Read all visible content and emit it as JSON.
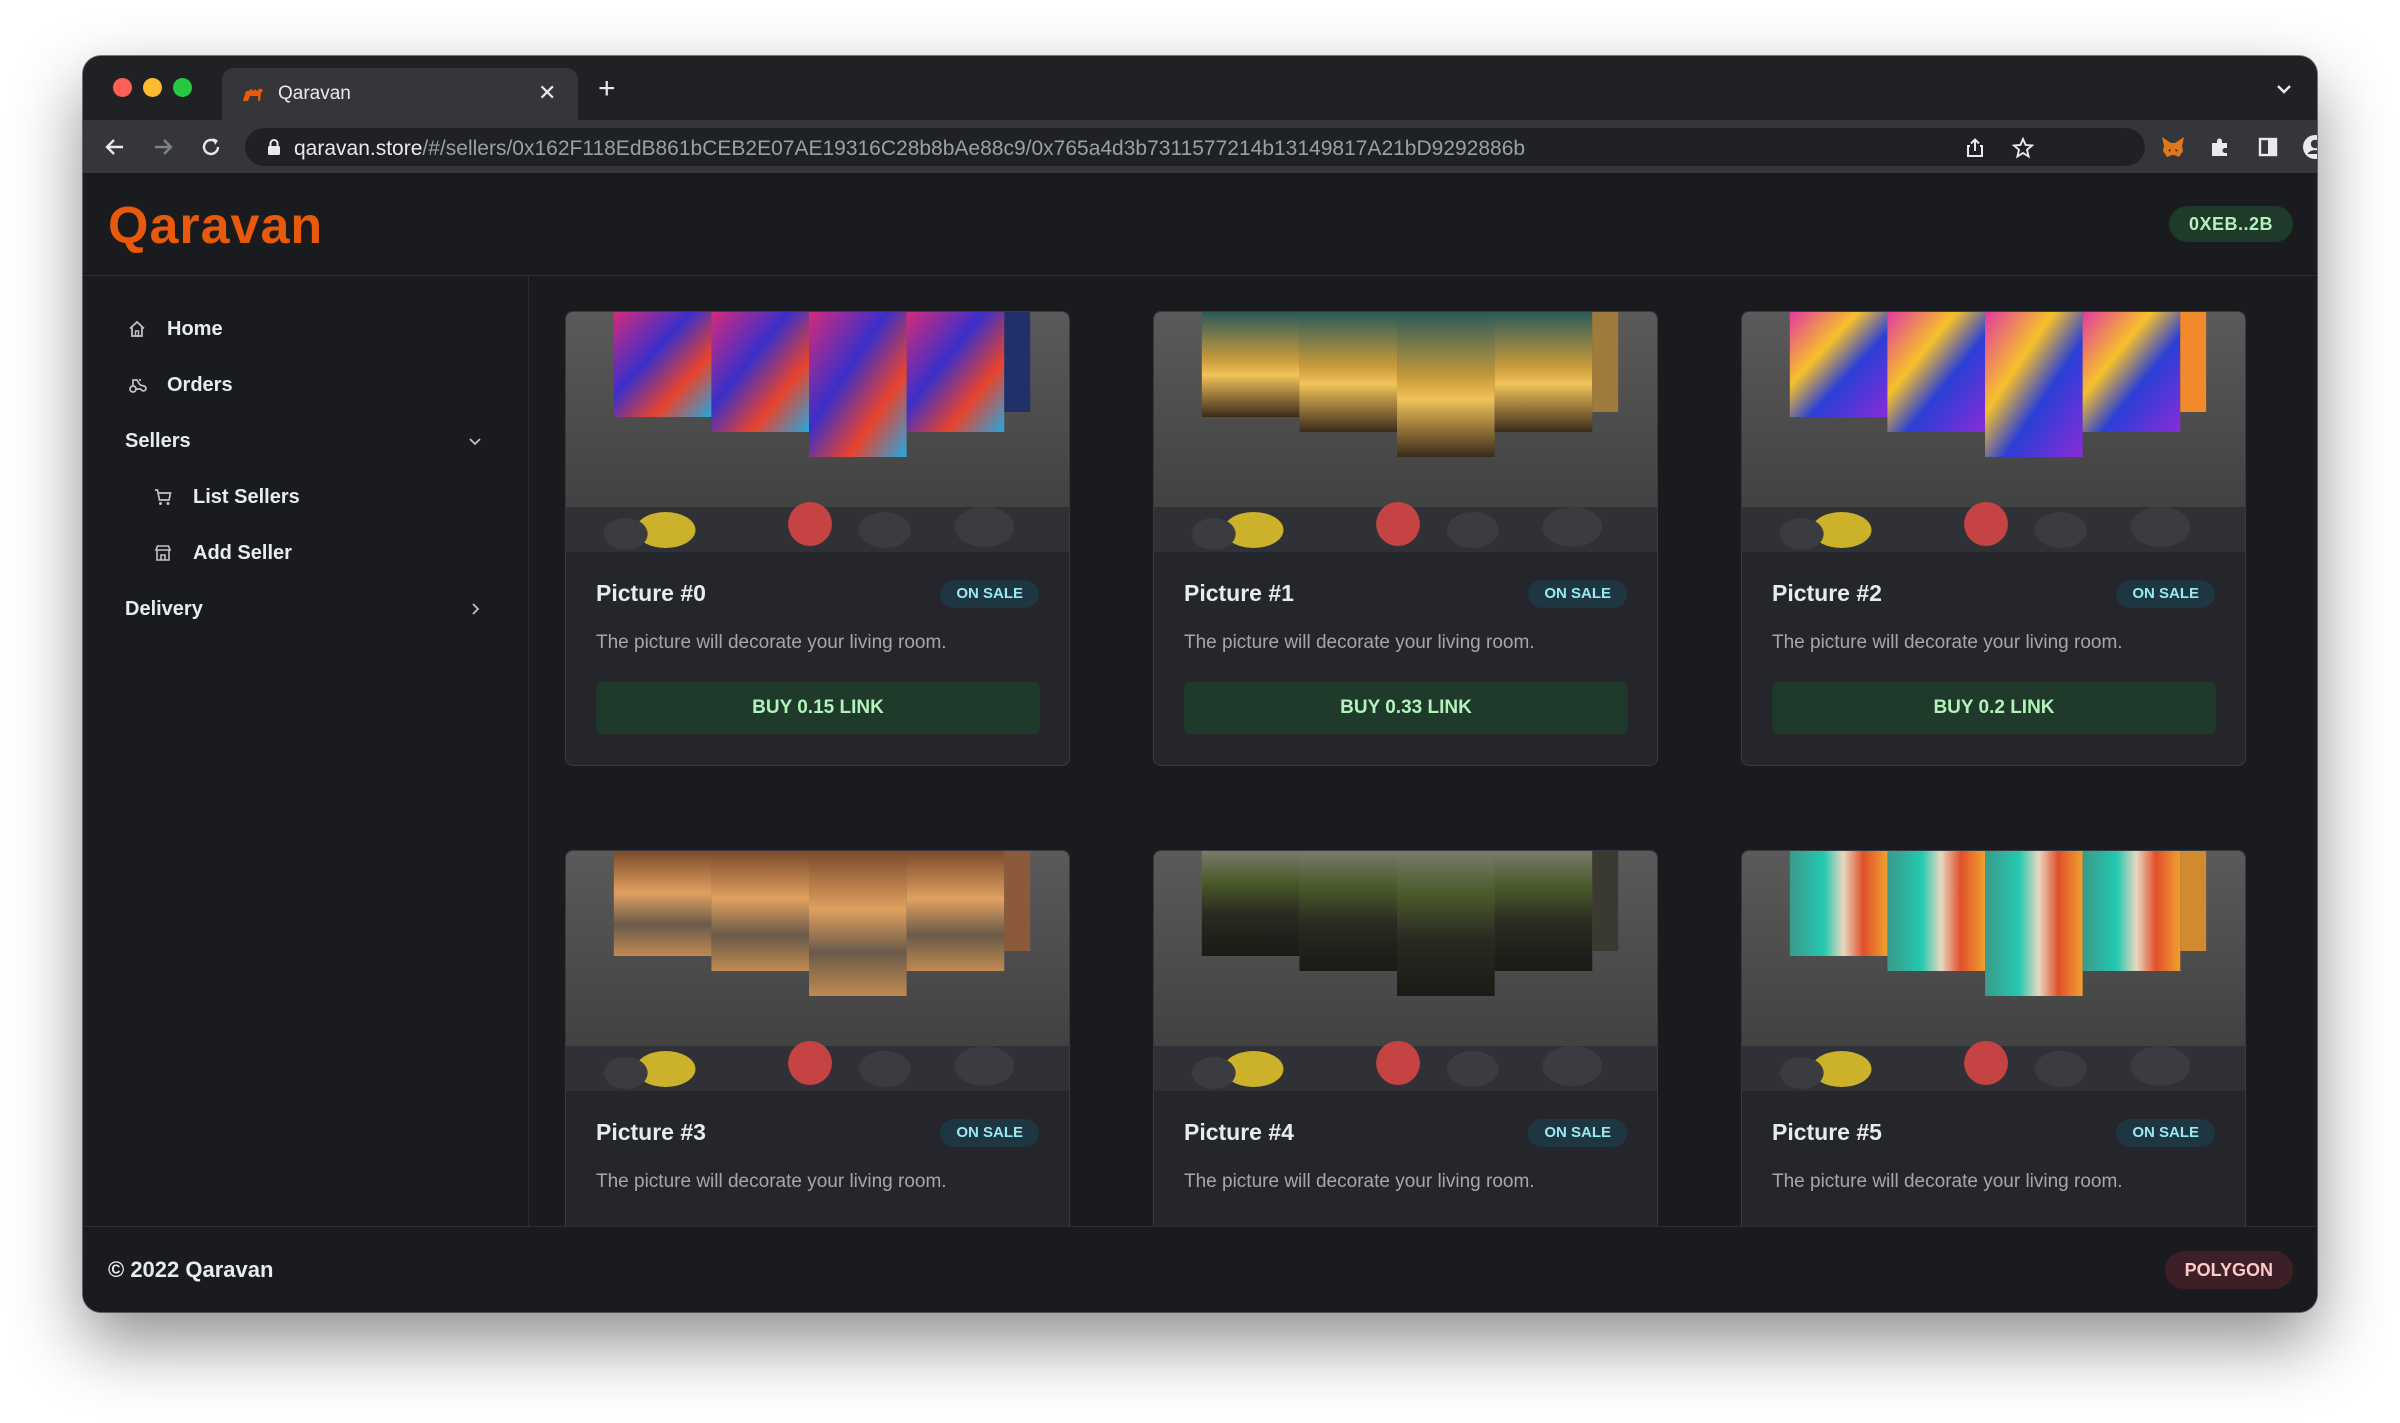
{
  "browser": {
    "tab_title": "Qaravan",
    "url_host": "qaravan.store",
    "url_path": "/#/sellers/0x162F118EdB861bCEB2E07AE19316C28b8bAe88c9/0x765a4d3b7311577214b13149817A21bD9292886b"
  },
  "app": {
    "logo": "Qaravan",
    "wallet": "0XEB..2B"
  },
  "sidebar": {
    "items": [
      {
        "label": "Home",
        "icon": "home-icon"
      },
      {
        "label": "Orders",
        "icon": "orders-icon"
      },
      {
        "label": "Sellers",
        "icon": "chevron-down-icon"
      },
      {
        "label": "List Sellers",
        "icon": "cart-icon"
      },
      {
        "label": "Add Seller",
        "icon": "building-store-icon"
      },
      {
        "label": "Delivery",
        "icon": "chevron-right-icon"
      }
    ]
  },
  "cards": [
    {
      "title": "Picture #0",
      "badge": "ON SALE",
      "description": "The picture will decorate your living room.",
      "button": "BUY 0.15 LINK"
    },
    {
      "title": "Picture #1",
      "badge": "ON SALE",
      "description": "The picture will decorate your living room.",
      "button": "BUY 0.33 LINK"
    },
    {
      "title": "Picture #2",
      "badge": "ON SALE",
      "description": "The picture will decorate your living room.",
      "button": "BUY 0.2 LINK"
    },
    {
      "title": "Picture #3",
      "badge": "ON SALE",
      "description": "The picture will decorate your living room."
    },
    {
      "title": "Picture #4",
      "badge": "ON SALE",
      "description": "The picture will decorate your living room."
    },
    {
      "title": "Picture #5",
      "badge": "ON SALE",
      "description": "The picture will decorate your living room."
    }
  ],
  "footer": {
    "copyright": "© 2022 Qaravan",
    "network": "POLYGON"
  },
  "colors": {
    "accent": "#e8590c",
    "background": "#1a1b1e",
    "card": "#25262b",
    "button_bg": "#1f3a2a",
    "button_text": "#b2f2bb",
    "badge_bg": "#1d3641",
    "badge_text": "#99e9f2"
  }
}
